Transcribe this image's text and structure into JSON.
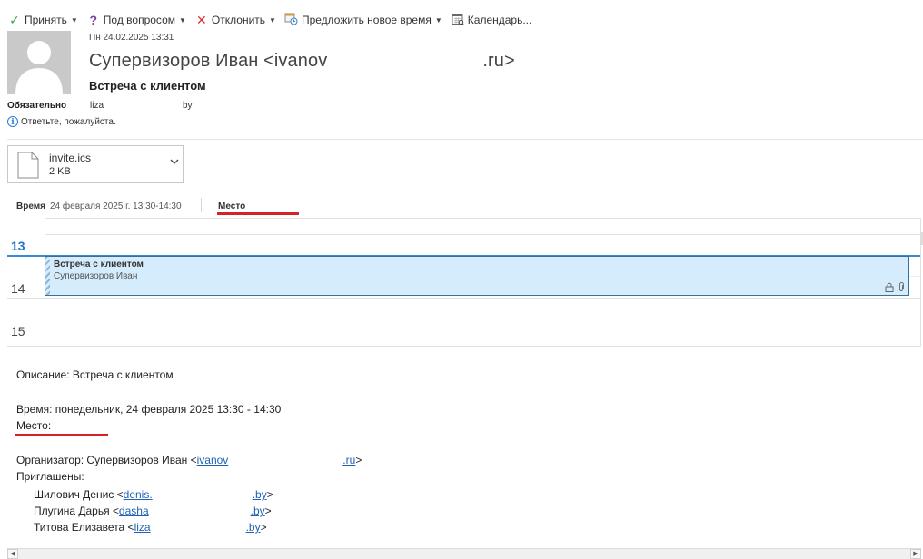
{
  "toolbar": {
    "accept_label": "Принять",
    "tentative_label": "Под вопросом",
    "decline_label": "Отклонить",
    "propose_label": "Предложить новое время",
    "calendar_label": "Календарь..."
  },
  "header": {
    "date": "Пн 24.02.2025 13:31",
    "sender_name": "Супервизоров Иван <ivanov",
    "sender_domain": ".ru>",
    "subject": "Встреча с клиентом",
    "required_label": "Обязательно",
    "required_value_1": "liza",
    "required_value_2": "by",
    "info_text": "Ответьте, пожалуйста."
  },
  "attachment": {
    "name": "invite.ics",
    "size": "2 KB"
  },
  "meeting": {
    "time_label": "Время",
    "time_value": "24 февраля 2025 г. 13:30-14:30",
    "place_label": "Место"
  },
  "calendar": {
    "hours": [
      "13",
      "14",
      "15"
    ],
    "appt_title": "Встреча с клиентом",
    "appt_organizer": "Супервизоров Иван"
  },
  "body": {
    "description": "Описание: Встреча с клиентом",
    "time_line": "Время: понедельник, 24 февраля 2025 13:30 - 14:30",
    "place_line": "Место:",
    "organizer_prefix": "Организатор: Супервизоров Иван <",
    "organizer_link1": "ivanov",
    "organizer_link2": ".ru",
    "organizer_suffix": ">",
    "invited_label": "Приглашены:",
    "invitees": [
      {
        "prefix": "Шилович Денис <",
        "link1": "denis.",
        "link2": ".by",
        "suffix": ">"
      },
      {
        "prefix": "Плугина Дарья <",
        "link1": "dasha",
        "link2": ".by",
        "suffix": ">"
      },
      {
        "prefix": "Титова Елизавета <",
        "link1": "liza",
        "link2": ".by",
        "suffix": ">"
      }
    ]
  },
  "colors": {
    "accept": "#3aa548",
    "tentative": "#7b3fa0",
    "decline": "#d9302c",
    "link": "#1f62b5",
    "highlight": "#d3222a",
    "appointment_fill": "#d4ecfb"
  },
  "icons": {
    "accept": "check-icon",
    "tentative": "question-icon",
    "decline": "cross-icon",
    "propose": "propose-time-icon",
    "calendar": "calendar-icon"
  }
}
